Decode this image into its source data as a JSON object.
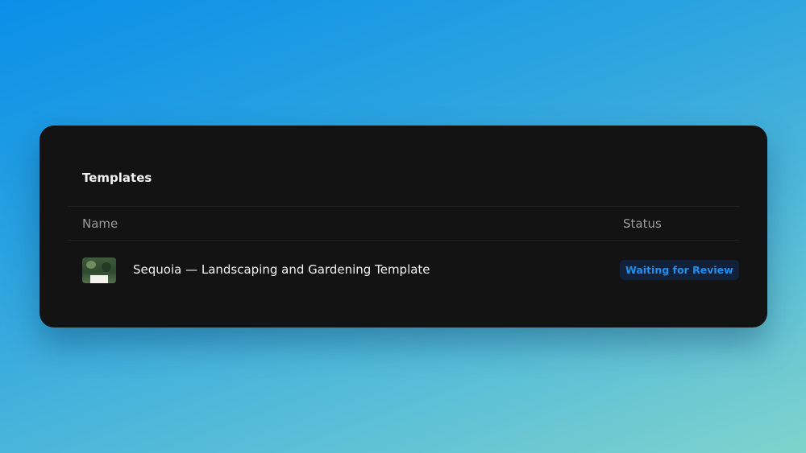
{
  "card": {
    "title": "Templates",
    "columns": {
      "name": "Name",
      "status": "Status"
    },
    "rows": [
      {
        "thumbnail_icon": "template-thumbnail",
        "name": "Sequoia — Landscaping and Gardening Template",
        "status": "Waiting for Review"
      }
    ]
  },
  "colors": {
    "card_background": "#131313",
    "status_badge_text": "#1f8ff0",
    "status_badge_background": "#12213a"
  }
}
